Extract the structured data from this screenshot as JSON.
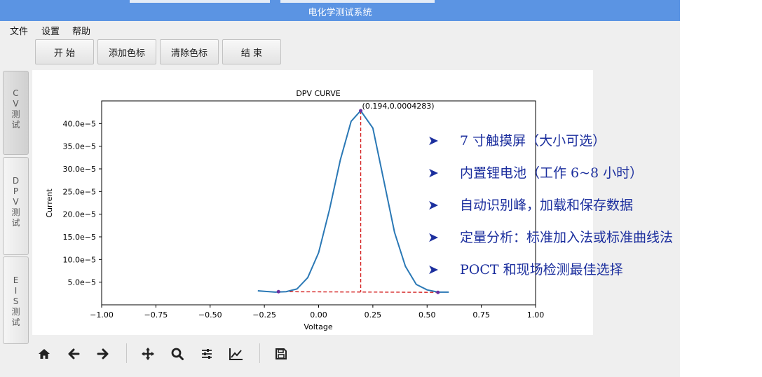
{
  "window": {
    "title": "电化学测试系统"
  },
  "menu": {
    "file": "文件",
    "settings": "设置",
    "help": "帮助"
  },
  "toolbar": {
    "start": "开 始",
    "add_marker": "添加色标",
    "clear_marker": "清除色标",
    "end": "结 束"
  },
  "side_tabs": {
    "cv": [
      "C",
      "V",
      "测",
      "试"
    ],
    "dpv": [
      "D",
      "P",
      "V",
      "测",
      "试"
    ],
    "eis": [
      "E",
      "I",
      "S",
      "测",
      "试"
    ]
  },
  "chart_data": {
    "type": "line",
    "title": "DPV CURVE",
    "xlabel": "Voltage",
    "ylabel": "Current",
    "xlim": [
      -1.0,
      1.0
    ],
    "ylim": [
      0.0,
      0.00045
    ],
    "x_ticks": [
      "−1.00",
      "−0.75",
      "−0.50",
      "−0.25",
      "0.00",
      "0.25",
      "0.50",
      "0.75",
      "1.00"
    ],
    "y_ticks": [
      "5.0e−5",
      "10.0e−5",
      "15.0e−5",
      "20.0e−5",
      "25.0e−5",
      "30.0e−5",
      "35.0e−5",
      "40.0e−5"
    ],
    "series": [
      {
        "color": "#2a78b5",
        "x": [
          -0.28,
          -0.2,
          -0.15,
          -0.1,
          -0.05,
          0.0,
          0.05,
          0.1,
          0.15,
          0.194,
          0.25,
          0.3,
          0.35,
          0.4,
          0.45,
          0.5,
          0.55,
          0.6
        ],
        "y": [
          3.1e-05,
          2.8e-05,
          2.9e-05,
          3.5e-05,
          6e-05,
          0.000115,
          0.00021,
          0.00032,
          0.000405,
          0.0004283,
          0.00039,
          0.000275,
          0.00016,
          8.5e-05,
          4.5e-05,
          3.3e-05,
          2.8e-05,
          2.8e-05
        ]
      }
    ],
    "peak": {
      "x": 0.194,
      "y": 0.0004283,
      "label": "(0.194,0.0004283)"
    },
    "baseline": {
      "x": [
        -0.185,
        0.55
      ],
      "y": [
        2.9e-05,
        2.75e-05
      ]
    },
    "annotation_color": "#d42020"
  },
  "features": [
    "7 寸触摸屏（大小可选）",
    "内置锂电池（工作 6~8 小时）",
    "自动识别峰，加载和保存数据",
    "定量分析：标准加入法或标准曲线法",
    "POCT 和现场检测最佳选择"
  ],
  "feature_bullet": "➤",
  "nav_icons": [
    "home-icon",
    "back-arrow-icon",
    "forward-arrow-icon",
    "pan-icon",
    "zoom-icon",
    "subplot-config-icon",
    "edit-axis-icon",
    "save-icon"
  ]
}
